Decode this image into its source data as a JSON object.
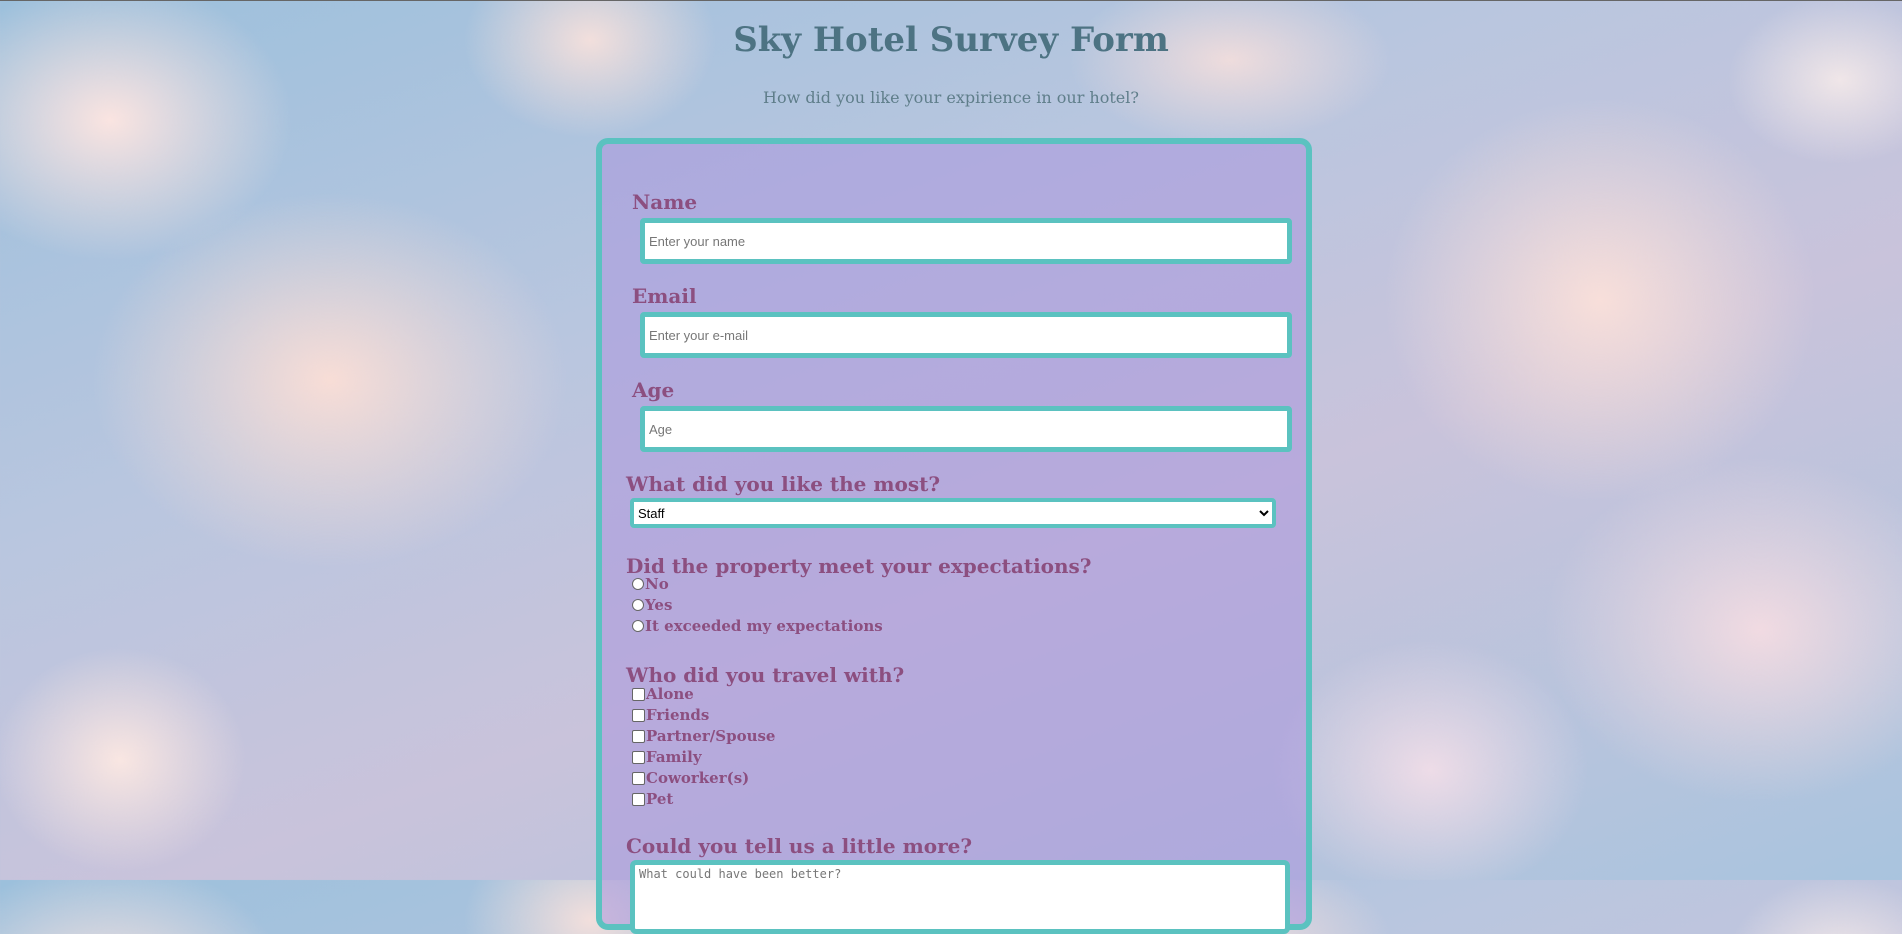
{
  "page": {
    "title": "Sky Hotel Survey Form",
    "subtitle": "How did you like your expirience in our hotel?"
  },
  "fields": {
    "name": {
      "label": "Name",
      "placeholder": "Enter your name",
      "value": ""
    },
    "email": {
      "label": "Email",
      "placeholder": "Enter your e-mail",
      "value": ""
    },
    "age": {
      "label": "Age",
      "placeholder": "Age",
      "value": ""
    }
  },
  "like_most": {
    "question": "What did you like the most?",
    "selected": "Staff"
  },
  "expectations": {
    "question": "Did the property meet your expectations?",
    "options": [
      "No",
      "Yes",
      "It exceeded my expectations"
    ]
  },
  "travel_with": {
    "question": "Who did you travel with?",
    "options": [
      "Alone",
      "Friends",
      "Partner/Spouse",
      "Family",
      "Coworker(s)",
      "Pet"
    ]
  },
  "more": {
    "question": "Could you tell us a little more?",
    "placeholder": "What could have been better?"
  },
  "colors": {
    "accent_border": "#5bc2c0",
    "label_text": "#8c4f80",
    "title_text": "#4d7383"
  }
}
